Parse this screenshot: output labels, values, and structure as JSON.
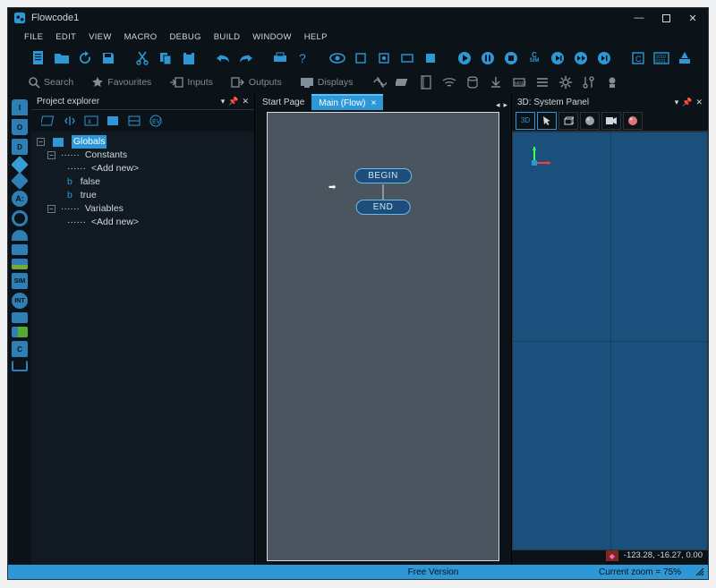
{
  "title": "Flowcode1",
  "menubar": [
    "FILE",
    "EDIT",
    "VIEW",
    "MACRO",
    "DEBUG",
    "BUILD",
    "WINDOW",
    "HELP"
  ],
  "toolbar2": {
    "search": "Search",
    "favourites": "Favourites",
    "inputs": "Inputs",
    "outputs": "Outputs",
    "displays": "Displays"
  },
  "project_explorer": {
    "title": "Project explorer",
    "dropdown_marker": "▾",
    "root": "Globals",
    "constants": "Constants",
    "variables": "Variables",
    "add_new": "<Add new>",
    "false": "false",
    "true": "true"
  },
  "tabs": {
    "start": "Start Page",
    "main": "Main (Flow)"
  },
  "flow": {
    "begin": "BEGIN",
    "end": "END"
  },
  "panel3d": {
    "title": "3D: System Panel",
    "badge": "3D",
    "coords": "-123.28, -16.27, 0.00"
  },
  "status": {
    "center": "Free Version",
    "right": "Current zoom = 75%"
  }
}
